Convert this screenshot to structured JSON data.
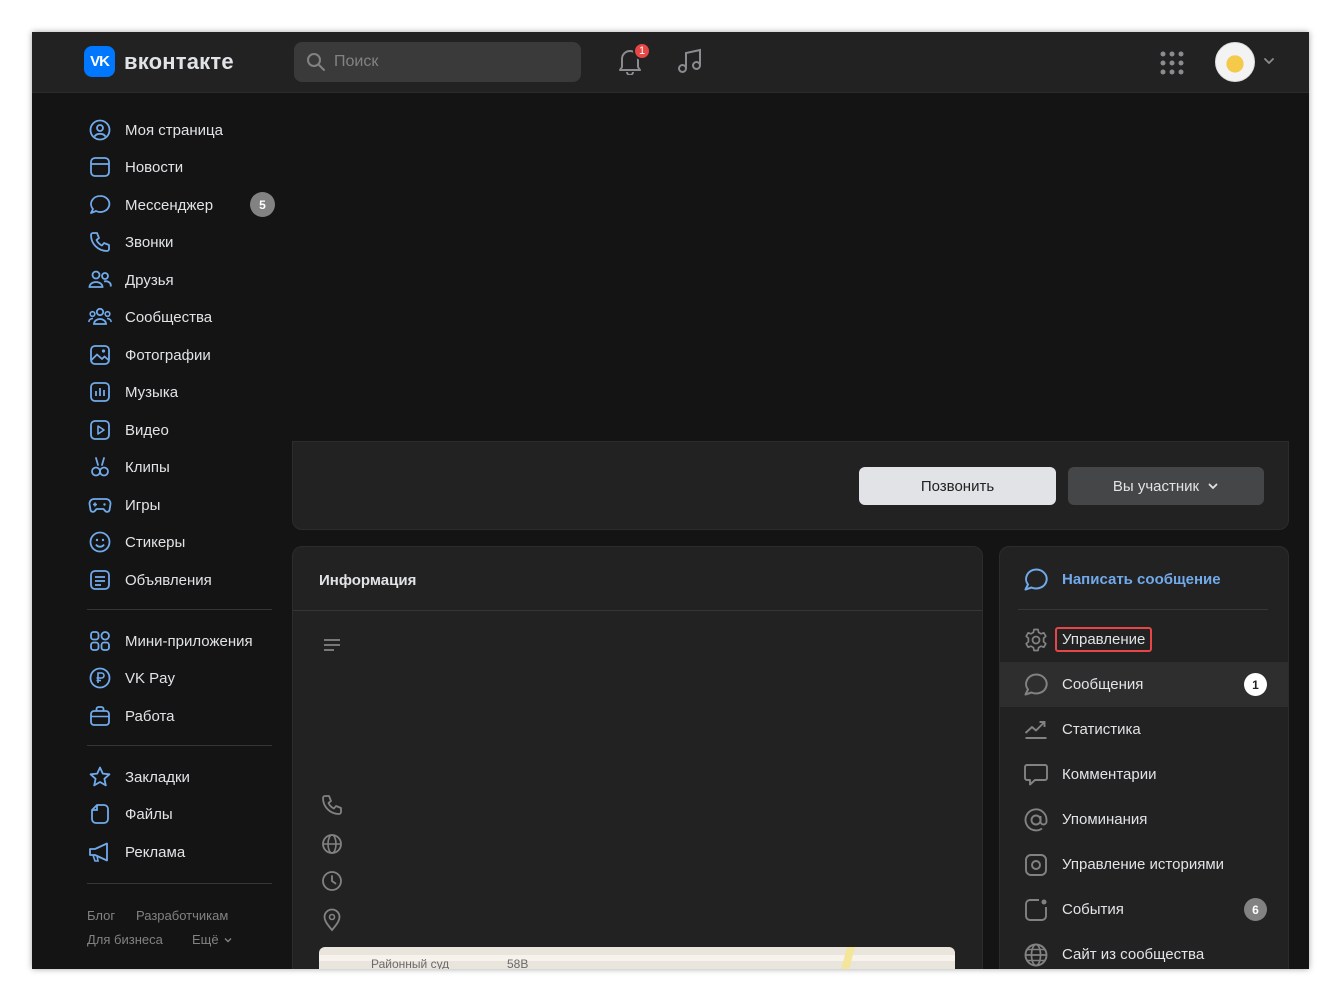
{
  "header": {
    "logo_text": "вконтакте",
    "search": {
      "placeholder": "Поиск"
    },
    "notifications_badge": "1"
  },
  "sidebar": {
    "items": [
      {
        "label": "Моя страница",
        "icon": "user-circle-icon"
      },
      {
        "label": "Новости",
        "icon": "news-icon"
      },
      {
        "label": "Мессенджер",
        "icon": "message-bubble-icon",
        "badge": "5"
      },
      {
        "label": "Звонки",
        "icon": "phone-icon"
      },
      {
        "label": "Друзья",
        "icon": "friends-icon"
      },
      {
        "label": "Сообщества",
        "icon": "communities-icon"
      },
      {
        "label": "Фотографии",
        "icon": "photo-icon"
      },
      {
        "label": "Музыка",
        "icon": "music-icon"
      },
      {
        "label": "Видео",
        "icon": "video-icon"
      },
      {
        "label": "Клипы",
        "icon": "clips-icon"
      },
      {
        "label": "Игры",
        "icon": "gamepad-icon"
      },
      {
        "label": "Стикеры",
        "icon": "smile-icon"
      },
      {
        "label": "Объявления",
        "icon": "ads-icon"
      },
      {
        "label": "Мини-приложения",
        "icon": "apps-grid-icon"
      },
      {
        "label": "VK Pay",
        "icon": "vkpay-icon"
      },
      {
        "label": "Работа",
        "icon": "briefcase-icon"
      },
      {
        "label": "Закладки",
        "icon": "star-icon"
      },
      {
        "label": "Файлы",
        "icon": "file-icon"
      },
      {
        "label": "Реклама",
        "icon": "megaphone-icon"
      }
    ],
    "footer": {
      "blog": "Блог",
      "developers": "Разработчикам",
      "business": "Для бизнеса",
      "more": "Ещё"
    }
  },
  "actions": {
    "call_label": "Позвонить",
    "member_label": "Вы участник"
  },
  "info": {
    "title": "Информация",
    "map_labels": [
      "Районный суд",
      "58В"
    ]
  },
  "menu": {
    "write_message": "Написать сообщение",
    "manage": "Управление",
    "items": [
      {
        "label": "Сообщения",
        "icon": "message-bubble-icon",
        "badge": "1"
      },
      {
        "label": "Статистика",
        "icon": "stats-icon"
      },
      {
        "label": "Комментарии",
        "icon": "comment-icon"
      },
      {
        "label": "Упоминания",
        "icon": "at-icon"
      },
      {
        "label": "Управление историями",
        "icon": "stories-icon"
      },
      {
        "label": "События",
        "icon": "events-icon",
        "badge": "6"
      },
      {
        "label": "Сайт из сообщества",
        "icon": "globe-icon"
      }
    ]
  },
  "colors": {
    "accent": "#0077ff",
    "link": "#71aaeb",
    "badge_red": "#e64646",
    "icon_blue": "#71aaeb"
  }
}
